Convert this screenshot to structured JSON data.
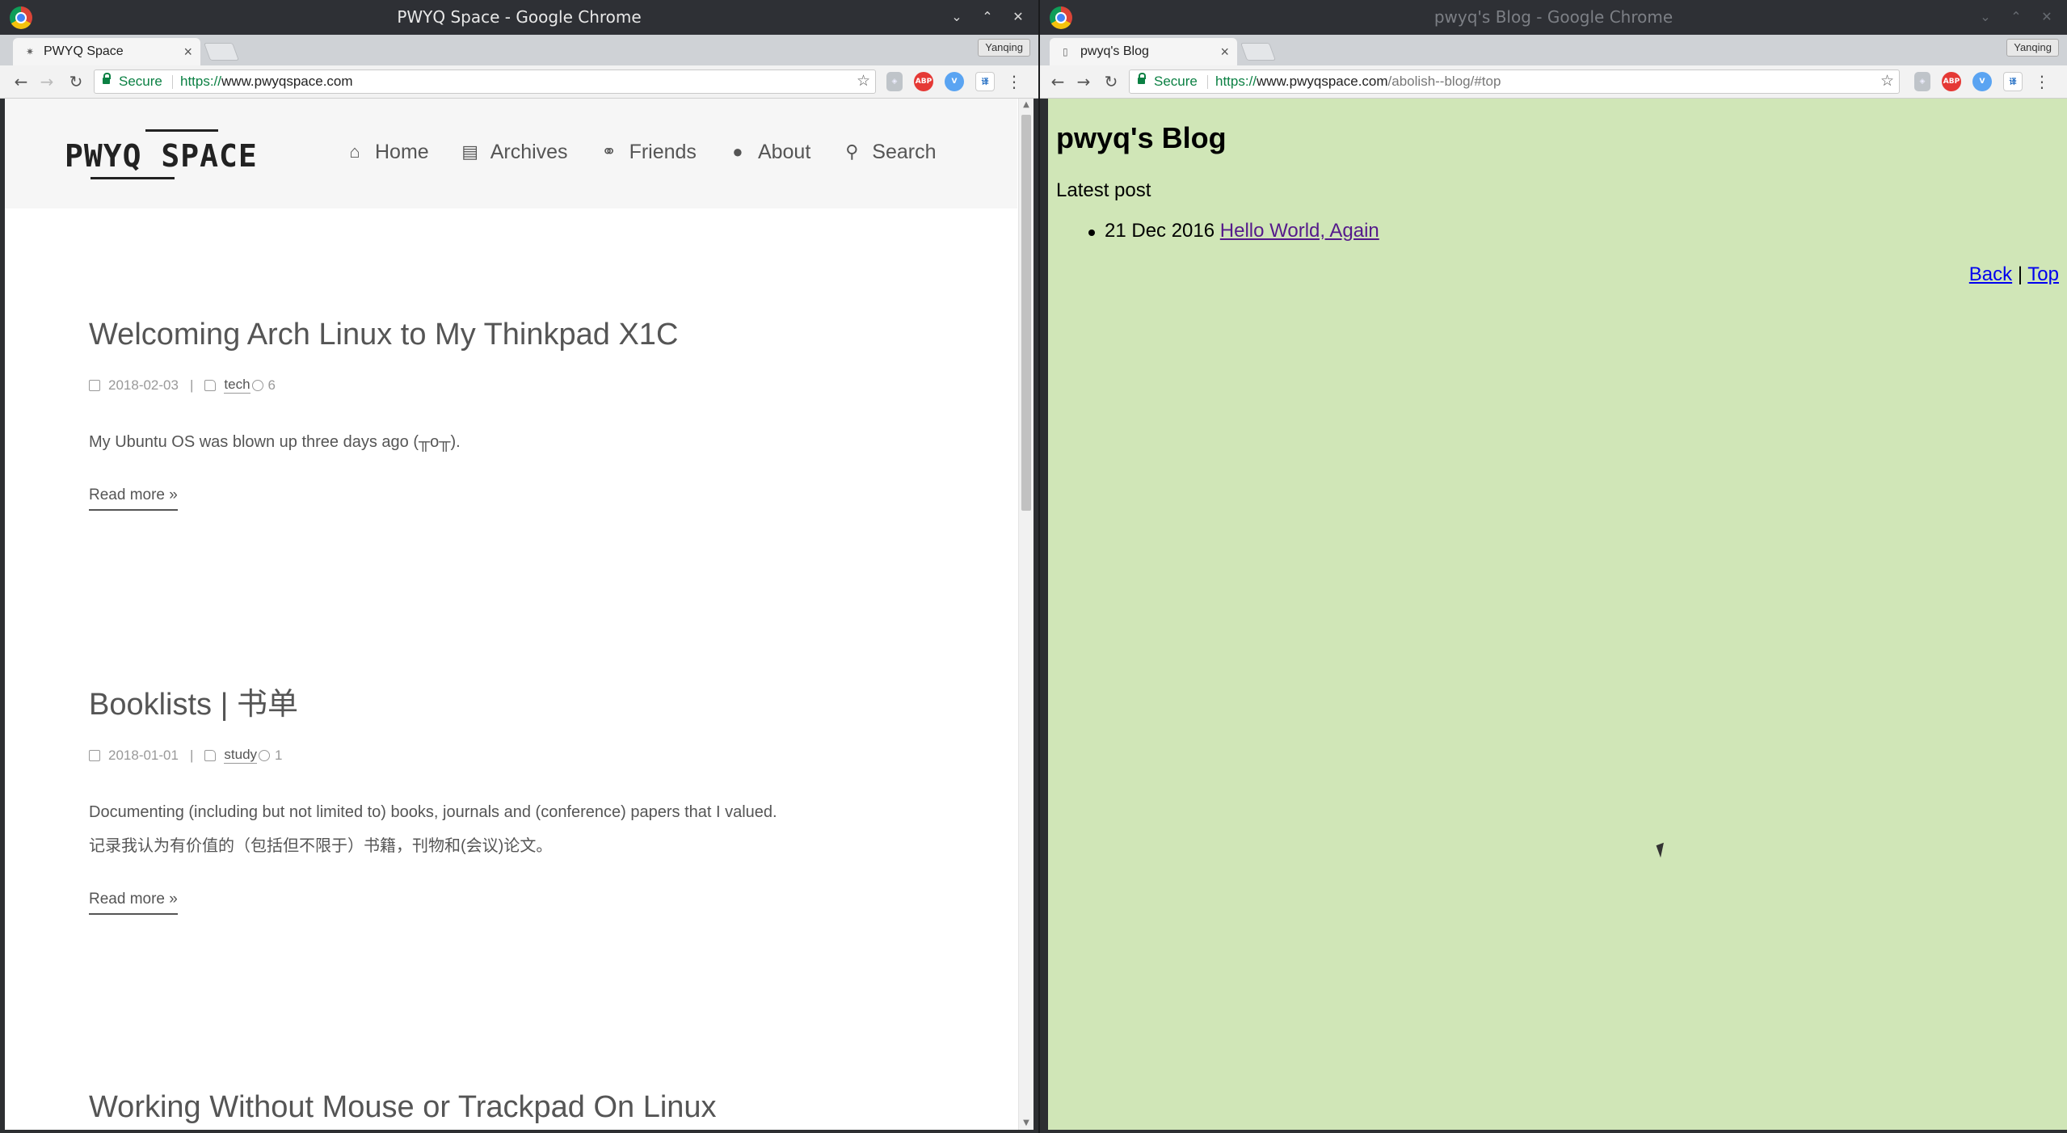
{
  "left_window": {
    "title": "PWYQ Space - Google Chrome",
    "tab_label": "PWYQ Space",
    "profile": "Yanqing",
    "secure_label": "Secure",
    "url_scheme": "https://",
    "url_host": "www.pwyqspace.com",
    "url_path": "",
    "page": {
      "logo": "PWYQ SPACE",
      "menu": [
        {
          "label": "Home",
          "icon": "home-icon"
        },
        {
          "label": "Archives",
          "icon": "archive-icon"
        },
        {
          "label": "Friends",
          "icon": "handshake-icon"
        },
        {
          "label": "About",
          "icon": "user-icon"
        },
        {
          "label": "Search",
          "icon": "search-icon"
        }
      ],
      "posts": [
        {
          "title": "Welcoming Arch Linux to My Thinkpad X1C",
          "date": "2018-02-03",
          "category": "tech",
          "views": "6",
          "excerpt": [
            "My Ubuntu OS was blown up three days ago (╥o╥)."
          ],
          "read_more": "Read more »"
        },
        {
          "title": "Booklists | 书单",
          "date": "2018-01-01",
          "category": "study",
          "views": "1",
          "excerpt": [
            "Documenting (including but not limited to) books, journals and (conference) papers that I valued.",
            "记录我认为有价值的（包括但不限于）书籍，刊物和(会议)论文。"
          ],
          "read_more": "Read more »"
        },
        {
          "title": "Working Without Mouse or Trackpad On Linux"
        }
      ]
    }
  },
  "right_window": {
    "title": "pwyq's Blog - Google Chrome",
    "tab_label": "pwyq's Blog",
    "profile": "Yanqing",
    "secure_label": "Secure",
    "url_scheme": "https://",
    "url_host": "www.pwyqspace.com",
    "url_path": "/abolish--blog/#top",
    "page": {
      "heading": "pwyq's Blog",
      "latest_label": "Latest post",
      "posts": [
        {
          "date": "21 Dec 2016",
          "title": "Hello World, Again"
        }
      ],
      "back_label": "Back",
      "separator": "|",
      "top_label": "Top"
    }
  },
  "colors": {
    "right_page_bg": "#d0e6b7",
    "secure_green": "#0b8043",
    "link_visited": "#551a8b",
    "link": "#0000ee"
  }
}
